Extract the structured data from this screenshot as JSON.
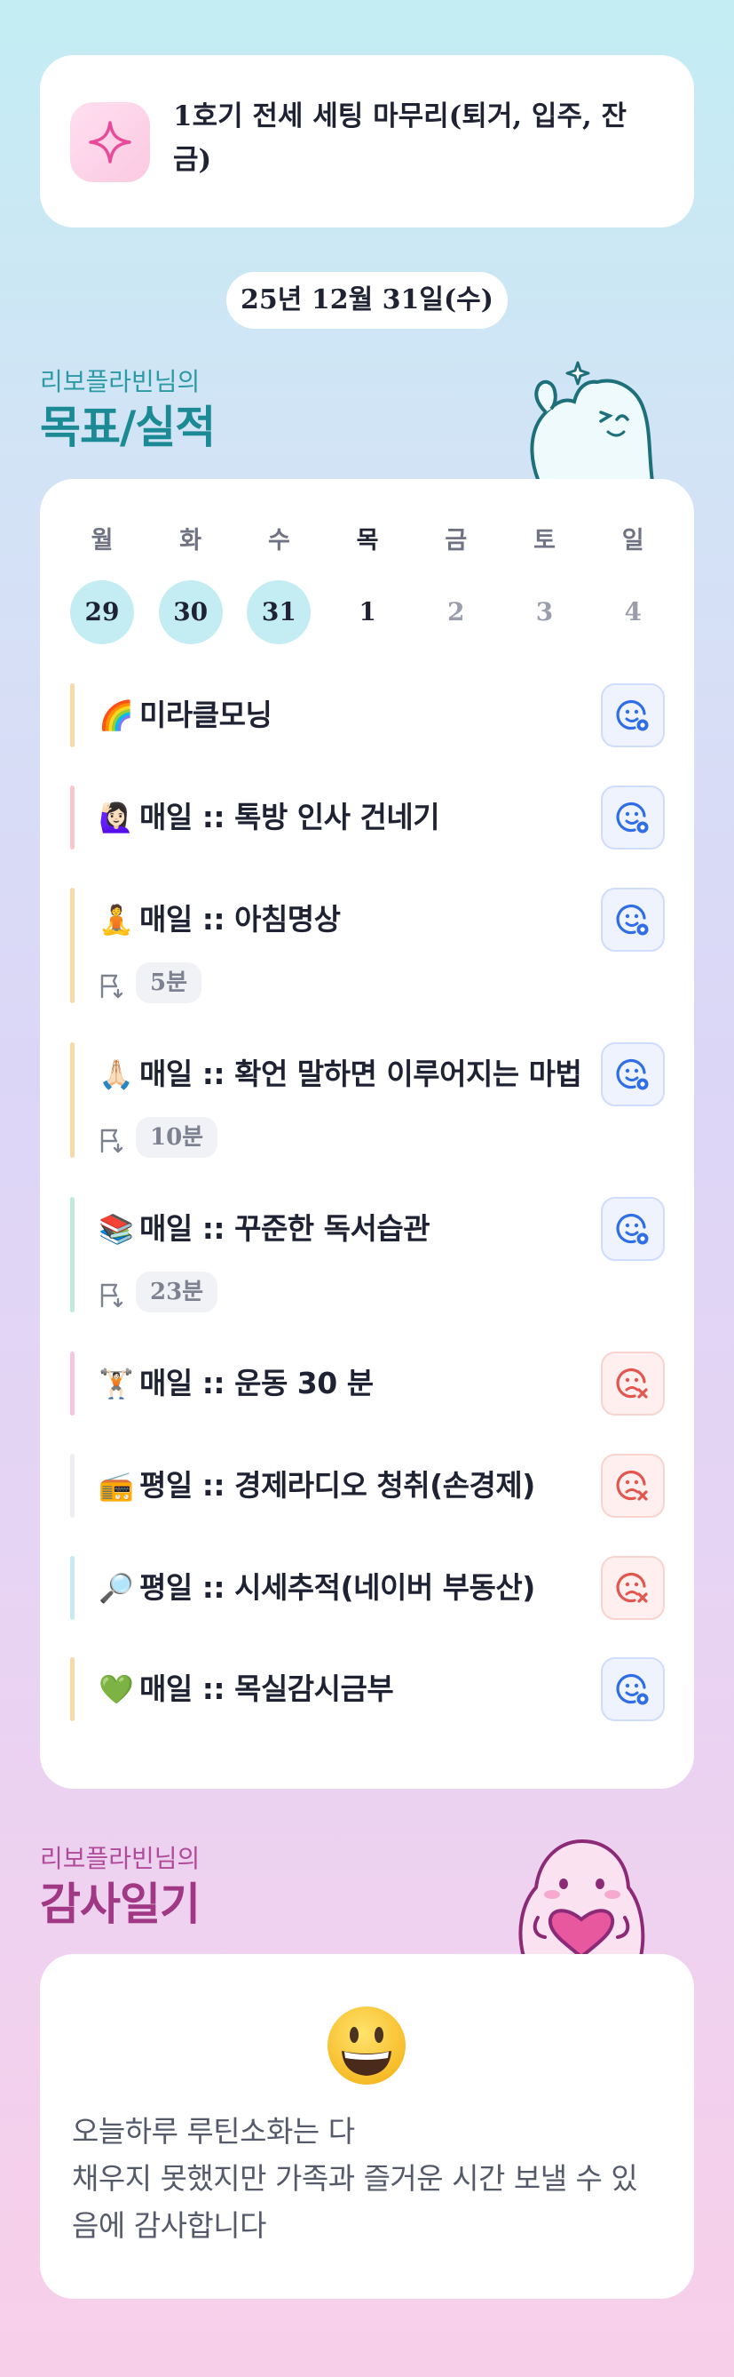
{
  "goal": {
    "icon": "sparkle-icon",
    "text": "1호기 전세 세팅 마무리(퇴거, 입주, 잔금)"
  },
  "date": "25년 12월 31일(수)",
  "routine_section": {
    "subtitle": "리보플라빈님의",
    "title": "목표/실적"
  },
  "week": [
    {
      "name": "월",
      "date": "29",
      "state": "done"
    },
    {
      "name": "화",
      "date": "30",
      "state": "done"
    },
    {
      "name": "수",
      "date": "31",
      "state": "done"
    },
    {
      "name": "목",
      "date": "1",
      "state": "current"
    },
    {
      "name": "금",
      "date": "2",
      "state": "future"
    },
    {
      "name": "토",
      "date": "3",
      "state": "future"
    },
    {
      "name": "일",
      "date": "4",
      "state": "future"
    }
  ],
  "routines": [
    {
      "emoji": "🌈",
      "label": "미라클모닝",
      "accent": "#f9d9a8",
      "status": "done"
    },
    {
      "emoji": "🙋🏻‍♀️",
      "label": "매일 :: 톡방 인사 건네기",
      "accent": "#f8c6cc",
      "status": "done"
    },
    {
      "emoji": "🧘",
      "label": "매일 :: 아침명상",
      "accent": "#f9d9a8",
      "status": "done",
      "duration": "5분"
    },
    {
      "emoji": "🙏🏻",
      "label": "매일 :: 확언 말하면 이루어지는 마법",
      "accent": "#f9d9a8",
      "status": "done",
      "duration": "10분"
    },
    {
      "emoji": "📚",
      "label": "매일 :: 꾸준한 독서습관",
      "accent": "#bfead9",
      "status": "done",
      "duration": "23분"
    },
    {
      "emoji": "🏋🏻",
      "label": "매일 :: 운동 30 분",
      "accent": "#f6c5e4",
      "status": "missed"
    },
    {
      "emoji": "📻",
      "label": "평일 :: 경제라디오 청취(손경제)",
      "accent": "#eceef2",
      "status": "missed"
    },
    {
      "emoji": "🔎",
      "label": "평일 :: 시세추적(네이버 부동산)",
      "accent": "#c5ebf1",
      "status": "missed"
    },
    {
      "emoji": "💚",
      "label": "매일 :: 목실감시금부",
      "accent": "#f9d9a8",
      "status": "done"
    }
  ],
  "diary_section": {
    "subtitle": "리보플라빈님의",
    "title": "감사일기"
  },
  "diary": {
    "emoji": "grinning-face-icon",
    "lines": [
      "오늘하루 루틴소화는 다",
      "채우지 못했지만 가족과 즐거운 시간 보낼 수 있",
      "음에 감사합니다"
    ]
  },
  "colors": {
    "done_icon": "#2f6ee6",
    "missed_icon": "#e2564d",
    "section1": "#1b8a94",
    "section2": "#a03885"
  }
}
